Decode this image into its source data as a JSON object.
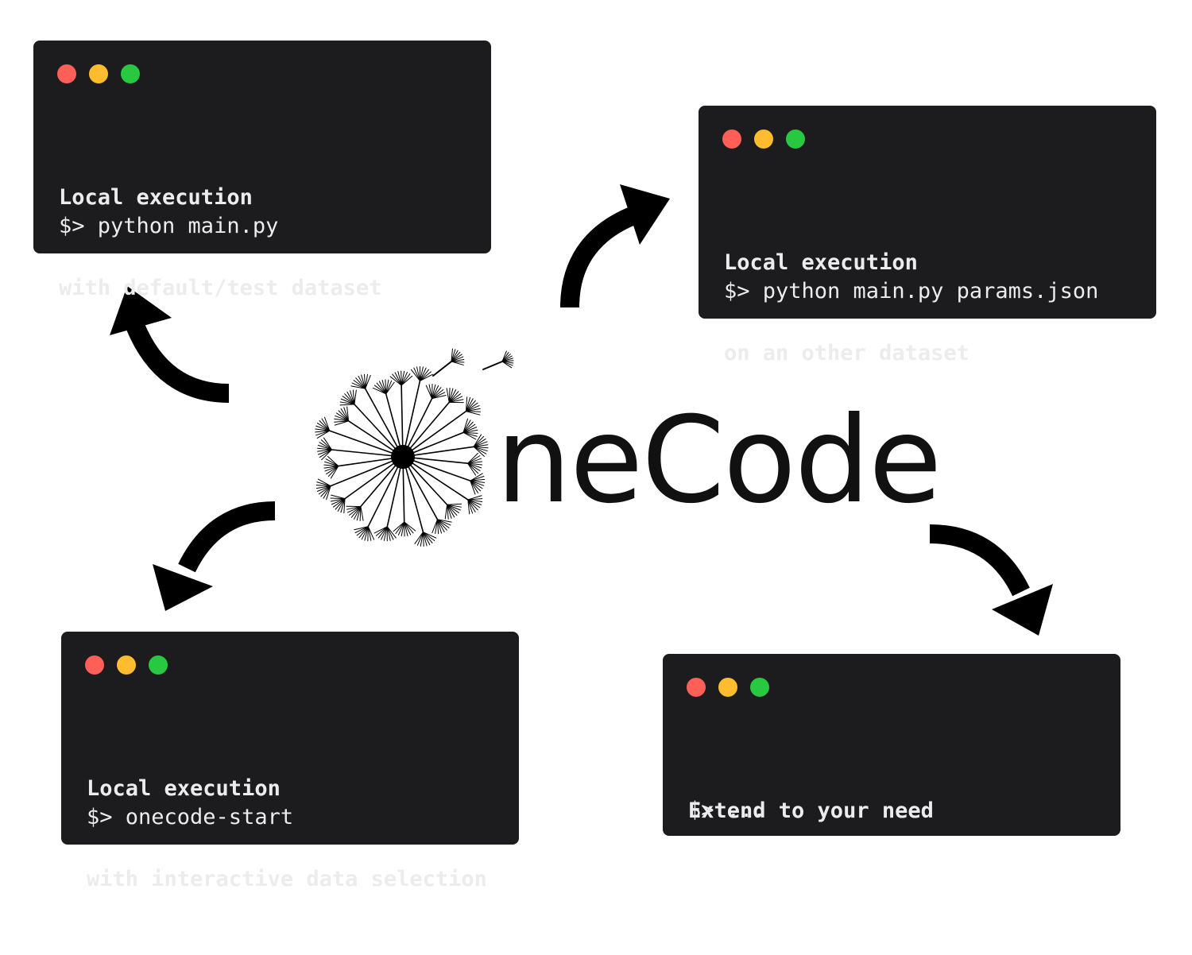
{
  "logo": {
    "word": "neCode",
    "dandelion_icon": "dandelion-icon"
  },
  "terminals": {
    "top_left": {
      "title_line1": "Local execution",
      "title_line2": "with default/test dataset",
      "command": "$> python main.py"
    },
    "top_right": {
      "title_line1": "Local execution",
      "title_line2": "on an other dataset",
      "command": "$> python main.py params.json"
    },
    "bottom_left": {
      "title_line1": "Local execution",
      "title_line2": "with interactive data selection",
      "command": "$> onecode-start"
    },
    "bottom_right": {
      "title_line1": "Extend to your need",
      "command": "$> ..."
    }
  },
  "colors": {
    "terminal_bg": "#1c1c1e",
    "terminal_text": "#ececec",
    "dot_red": "#fe5f57",
    "dot_yellow": "#febc2e",
    "dot_green": "#28c840",
    "arrow": "#000000"
  }
}
